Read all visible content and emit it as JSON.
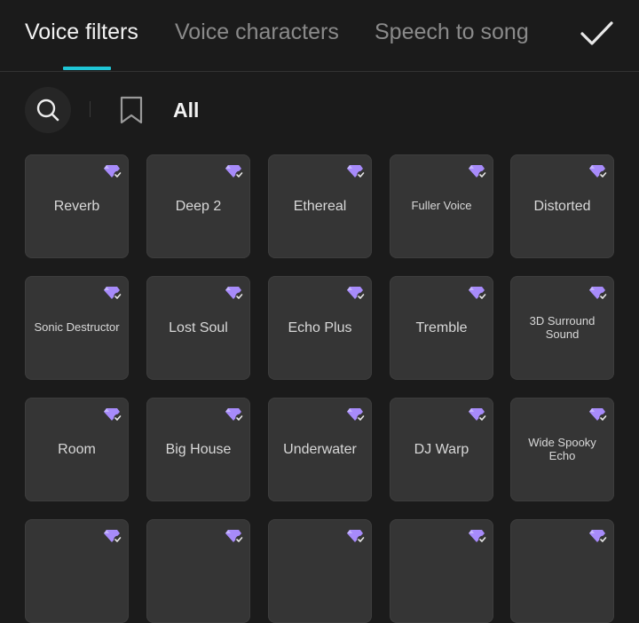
{
  "tabs": [
    {
      "label": "Voice filters",
      "active": true
    },
    {
      "label": "Voice characters",
      "active": false
    },
    {
      "label": "Speech to song",
      "active": false
    }
  ],
  "icons": {
    "confirm": "checkmark-icon",
    "search": "search-icon",
    "bookmark": "bookmark-icon",
    "premium": "premium-diamond-icon"
  },
  "colors": {
    "accent": "#1fc6d6",
    "premium_gem": "#a78bfa",
    "background": "#1b1b1b",
    "tile": "#353535"
  },
  "toolbar": {
    "all_label": "All"
  },
  "filters": [
    {
      "label": "Reverb",
      "premium": true
    },
    {
      "label": "Deep 2",
      "premium": true
    },
    {
      "label": "Ethereal",
      "premium": true
    },
    {
      "label": "Fuller Voice",
      "premium": true
    },
    {
      "label": "Distorted",
      "premium": true
    },
    {
      "label": "Sonic Destructor",
      "premium": true
    },
    {
      "label": "Lost Soul",
      "premium": true
    },
    {
      "label": "Echo Plus",
      "premium": true
    },
    {
      "label": "Tremble",
      "premium": true
    },
    {
      "label": "3D Surround Sound",
      "premium": true
    },
    {
      "label": "Room",
      "premium": true
    },
    {
      "label": "Big House",
      "premium": true
    },
    {
      "label": "Underwater",
      "premium": true
    },
    {
      "label": "DJ Warp",
      "premium": true
    },
    {
      "label": "Wide Spooky Echo",
      "premium": true
    },
    {
      "label": "",
      "premium": true
    },
    {
      "label": "",
      "premium": true
    },
    {
      "label": "",
      "premium": true
    },
    {
      "label": "",
      "premium": true
    },
    {
      "label": "",
      "premium": true
    }
  ]
}
